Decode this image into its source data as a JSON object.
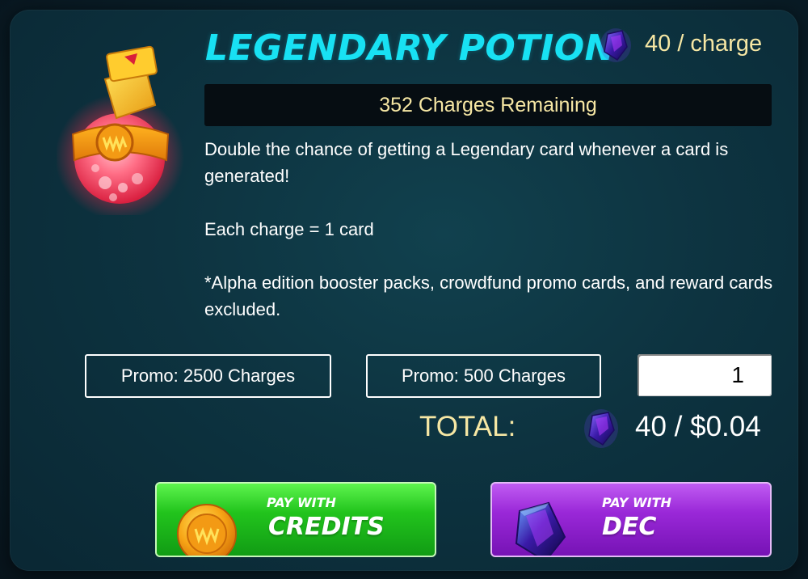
{
  "item": {
    "title": "LEGENDARY POTION",
    "icon": "legendary-potion-icon",
    "price_per_charge": "40 / charge",
    "charges_remaining": "352 Charges Remaining",
    "description": [
      "Double the chance of getting a Legendary card whenever a card is generated!",
      "Each charge = 1 card",
      "*Alpha edition booster packs, crowdfund promo cards, and reward cards excluded."
    ]
  },
  "promos": [
    {
      "label": "Promo: 2500 Charges"
    },
    {
      "label": "Promo: 500 Charges"
    }
  ],
  "quantity": {
    "value": "1"
  },
  "total": {
    "label": "TOTAL:",
    "value": "40 / $0.04"
  },
  "buttons": {
    "credits": {
      "small": "PAY WITH",
      "big": "CREDITS",
      "icon": "credits-coin-icon"
    },
    "dec": {
      "small": "PAY WITH",
      "big": "DEC",
      "icon": "dec-shard-icon"
    }
  },
  "colors": {
    "title": "#18e1f3",
    "gold_text": "#f6e7a4",
    "panel_bg": "#0d3340",
    "credits_button": "#22c41d",
    "dec_button": "#9a28d8"
  }
}
